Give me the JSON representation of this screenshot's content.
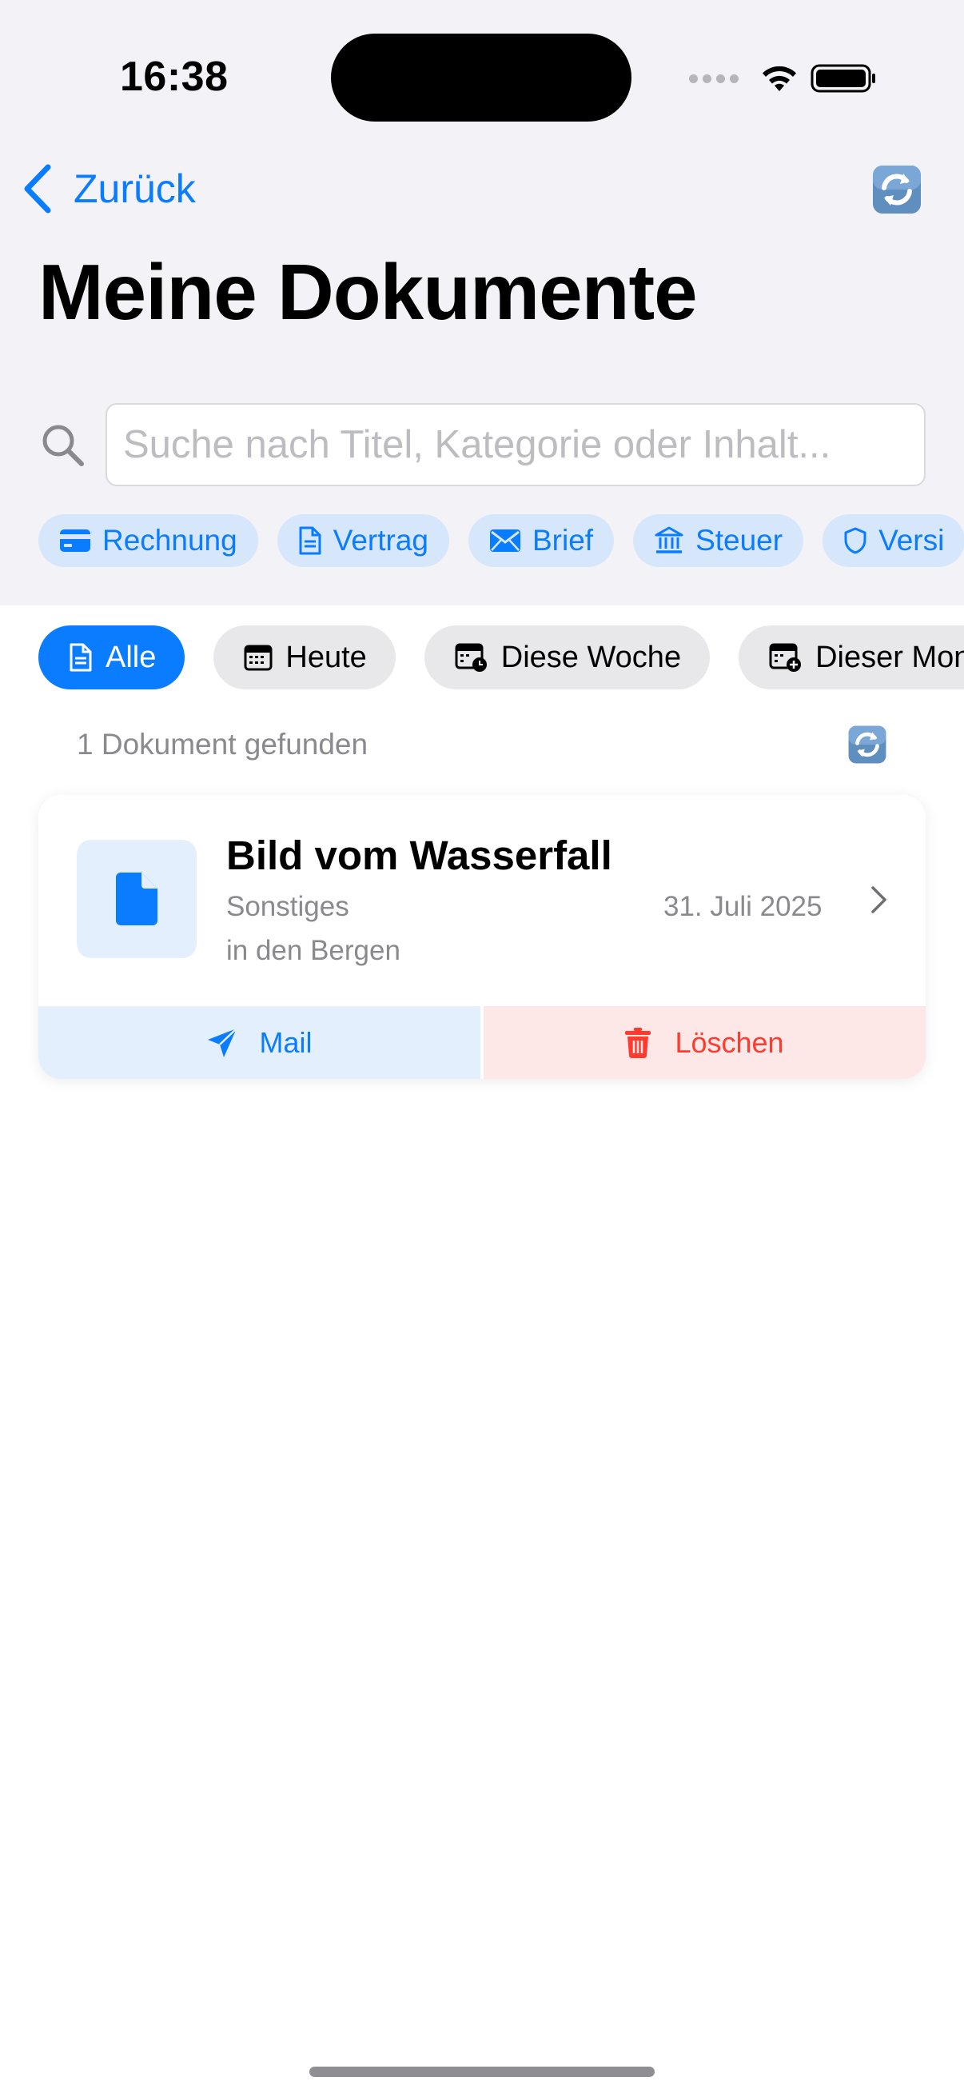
{
  "status_bar": {
    "time": "16:38"
  },
  "nav": {
    "back_label": "Zurück"
  },
  "page": {
    "title": "Meine Dokumente"
  },
  "search": {
    "placeholder": "Suche nach Titel, Kategorie oder Inhalt...",
    "value": ""
  },
  "categories": [
    {
      "label": "Rechnung",
      "icon": "credit-card-icon"
    },
    {
      "label": "Vertrag",
      "icon": "document-icon"
    },
    {
      "label": "Brief",
      "icon": "envelope-icon"
    },
    {
      "label": "Steuer",
      "icon": "bank-icon"
    },
    {
      "label": "Versi",
      "icon": "shield-icon"
    }
  ],
  "filters": [
    {
      "label": "Alle",
      "icon": "document-icon",
      "active": true
    },
    {
      "label": "Heute",
      "icon": "calendar-icon",
      "active": false
    },
    {
      "label": "Diese Woche",
      "icon": "calendar-clock-icon",
      "active": false
    },
    {
      "label": "Dieser Mon",
      "icon": "calendar-plus-icon",
      "active": false
    }
  ],
  "results": {
    "count_text": "1 Dokument gefunden"
  },
  "documents": [
    {
      "title": "Bild vom Wasserfall",
      "category": "Sonstiges",
      "subtitle": "in den Bergen",
      "date": "31. Juli 2025",
      "icon": "file-icon"
    }
  ],
  "actions": {
    "mail_label": "Mail",
    "delete_label": "Löschen"
  },
  "colors": {
    "accent": "#0a7cff",
    "danger": "#ff3b30",
    "header_bg": "#f2f2f7",
    "chip_bg": "#d6e6fb"
  }
}
